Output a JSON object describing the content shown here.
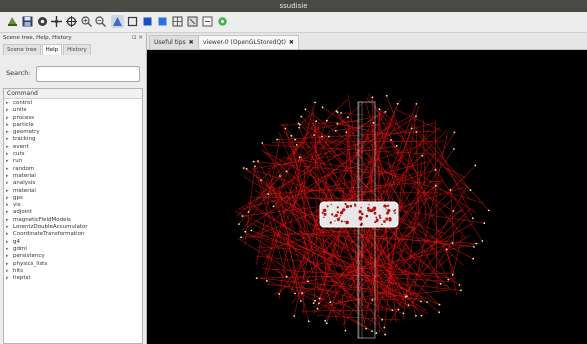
{
  "window": {
    "title": "ssudisie"
  },
  "toolbar": {
    "icons": [
      "run-icon",
      "save-icon",
      "settings-icon",
      "move-icon",
      "rotate-icon",
      "zoom-in-icon",
      "zoom-out-icon",
      "perspective-icon",
      "ortho-icon",
      "surface-icon",
      "solid-icon",
      "wireframe-icon",
      "hidden-line-icon",
      "export-icon",
      "viewer-properties-icon"
    ]
  },
  "left_panel": {
    "title": "Scene tree, Help, History",
    "controls": "⊡ ✕",
    "tabs": [
      "Scene tree",
      "Help",
      "History"
    ],
    "search_label": "Search:",
    "search_value": "",
    "command_header": "Command",
    "commands": [
      "control",
      "units",
      "process",
      "particle",
      "geometry",
      "tracking",
      "event",
      "cuts",
      "run",
      "random",
      "material",
      "analysis",
      "material",
      "gps",
      "vis",
      "adjoint",
      "magneticFieldModels",
      "LorentzDoubleAccumulator",
      "CoordinateTransformation",
      "g4",
      "gdml",
      "persistency",
      "physics_lists",
      "hits",
      "heptst"
    ]
  },
  "viewer": {
    "tabs": [
      {
        "label": "Useful tips",
        "close": "✖"
      },
      {
        "label": "viewer-0 (OpenGLStoredQt)",
        "close": "✖"
      }
    ],
    "track_color": "#e01010",
    "background": "#000000"
  }
}
